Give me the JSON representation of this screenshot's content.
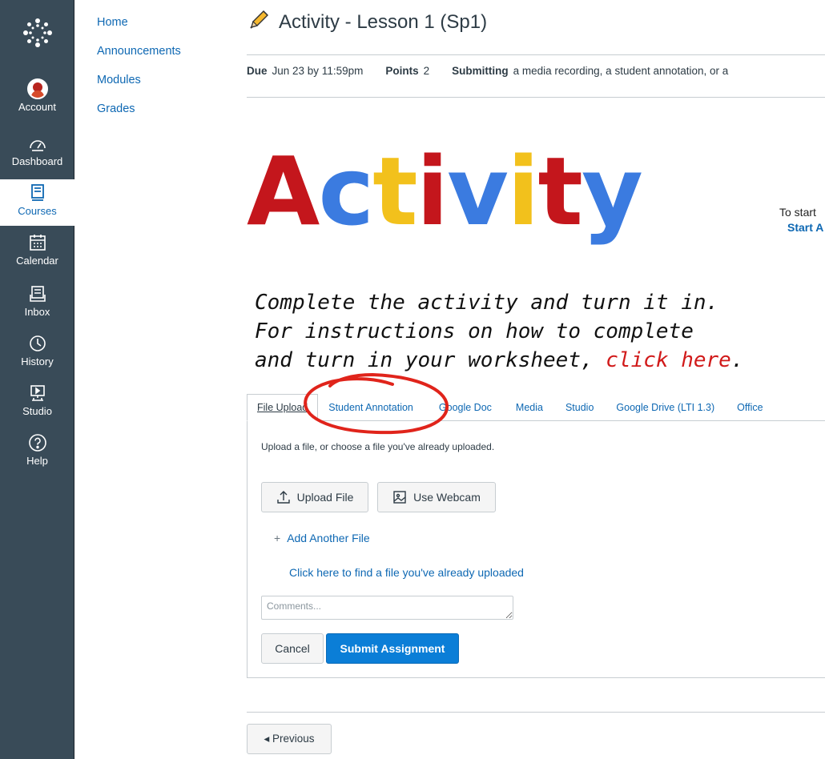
{
  "global_nav": {
    "items": [
      {
        "label": "Account",
        "icon": "account-avatar-icon"
      },
      {
        "label": "Dashboard",
        "icon": "dashboard-icon"
      },
      {
        "label": "Courses",
        "icon": "courses-icon",
        "active": true
      },
      {
        "label": "Calendar",
        "icon": "calendar-icon"
      },
      {
        "label": "Inbox",
        "icon": "inbox-icon"
      },
      {
        "label": "History",
        "icon": "history-icon"
      },
      {
        "label": "Studio",
        "icon": "studio-icon"
      },
      {
        "label": "Help",
        "icon": "help-icon"
      }
    ]
  },
  "course_nav": {
    "items": [
      {
        "label": "Home"
      },
      {
        "label": "Announcements"
      },
      {
        "label": "Modules"
      },
      {
        "label": "Grades"
      }
    ]
  },
  "assignment": {
    "title": "Activity - Lesson 1 (Sp1)",
    "title_icon": "pencil-icon",
    "due_label": "Due",
    "due_value": "Jun 23 by 11:59pm",
    "points_label": "Points",
    "points_value": "2",
    "submitting_label": "Submitting",
    "submitting_value": "a media recording, a student annotation, or a"
  },
  "banner": {
    "word_letters": [
      {
        "ch": "A",
        "color": "#c4161c"
      },
      {
        "ch": "c",
        "color": "#3b7be0"
      },
      {
        "ch": "t",
        "color": "#f2c11c"
      },
      {
        "ch": "i",
        "color": "#c4161c"
      },
      {
        "ch": "v",
        "color": "#3b7be0"
      },
      {
        "ch": "i",
        "color": "#f2c11c"
      },
      {
        "ch": "t",
        "color": "#c4161c"
      },
      {
        "ch": "y",
        "color": "#3b7be0"
      }
    ],
    "line1": "Complete the activity and turn it in.",
    "line2": "For instructions on how to complete",
    "line3_prefix": "and turn in your worksheet, ",
    "line3_link": "click here",
    "line3_suffix": "."
  },
  "side_prompt": {
    "text": "To start",
    "link": "Start A"
  },
  "submission": {
    "tabs": [
      {
        "label": "File Upload",
        "active": true
      },
      {
        "label": "Student Annotation"
      },
      {
        "label": "Google Doc"
      },
      {
        "label": "Media"
      },
      {
        "label": "Studio"
      },
      {
        "label": "Google Drive (LTI 1.3)"
      },
      {
        "label": "Office"
      }
    ],
    "hint": "Upload a file, or choose a file you've already uploaded.",
    "upload_button": "Upload File",
    "webcam_button": "Use Webcam",
    "add_another": "Add Another File",
    "find_uploaded": "Click here to find a file you've already uploaded",
    "comments_placeholder": "Comments...",
    "cancel_button": "Cancel",
    "submit_button": "Submit Assignment"
  },
  "footer": {
    "previous_button": "◂ Previous"
  },
  "colors": {
    "nav_bg": "#394b58",
    "link": "#0e68b3",
    "primary": "#0b7ed7",
    "annotation_circle": "#e0241b"
  }
}
